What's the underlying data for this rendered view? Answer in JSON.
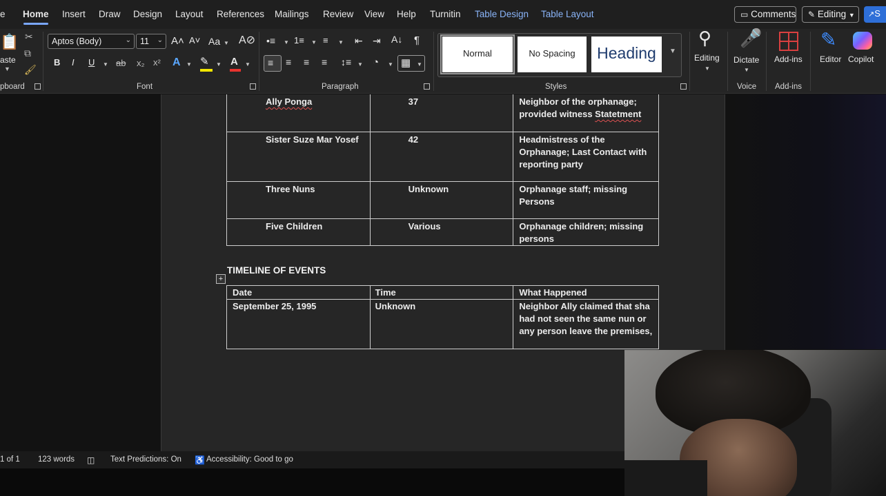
{
  "menu": {
    "file_fragment": "e",
    "tabs": [
      "Home",
      "Insert",
      "Draw",
      "Design",
      "Layout",
      "References",
      "Mailings",
      "Review",
      "View",
      "Help",
      "Turnitin"
    ],
    "context_tabs": [
      "Table Design",
      "Table Layout"
    ],
    "comments_label": "Comments",
    "editing_label": "Editing",
    "share_fragment": "S"
  },
  "ribbon": {
    "clipboard": {
      "paste_fragment": "aste",
      "label_fragment": "pboard"
    },
    "font": {
      "name": "Aptos (Body)",
      "size": "11",
      "grow_glyph": "A˄",
      "shrink_glyph": "A˅",
      "case_glyph": "Aa",
      "bold": "B",
      "italic": "I",
      "underline": "U",
      "strike": "ab",
      "subscript": "x₂",
      "superscript": "x²",
      "label": "Font"
    },
    "paragraph": {
      "label": "Paragraph",
      "pilcrow": "¶"
    },
    "styles": {
      "items": [
        "Normal",
        "No Spacing",
        "Heading"
      ],
      "label": "Styles"
    },
    "editing": {
      "label": "Editing"
    },
    "voice": {
      "dictate": "Dictate",
      "label": "Voice"
    },
    "addins": {
      "addins": "Add-ins",
      "label": "Add-ins"
    },
    "editor": {
      "label": "Editor"
    },
    "copilot": {
      "label": "Copilot"
    }
  },
  "document": {
    "persons_rows": [
      {
        "name": "Ally Ponga",
        "age": "37",
        "role_parts": [
          "Neighbor of the orphanage; provided witness ",
          "Statetment"
        ]
      },
      {
        "name": "Sister Suze Mar Yosef",
        "age": "42",
        "role": "Headmistress of the Orphanage; Last Contact with reporting party"
      },
      {
        "name": "Three Nuns",
        "age": "Unknown",
        "role": "Orphanage staff; missing Persons"
      },
      {
        "name": "Five Children",
        "age": "Various",
        "role": "Orphanage children; missing persons"
      }
    ],
    "timeline_heading": "TIMELINE OF EVENTS",
    "move_handle": "+",
    "timeline_headers": [
      "Date",
      "Time",
      "What Happened"
    ],
    "timeline_rows": [
      {
        "date": "September 25, 1995",
        "time": "Unknown",
        "what": "Neighbor Ally claimed that sha had not seen the same nun or any person leave the premises,"
      }
    ]
  },
  "status": {
    "page": "1 of 1",
    "words": "123 words",
    "predictions": "Text Predictions: On",
    "accessibility": "Accessibility: Good to go"
  }
}
